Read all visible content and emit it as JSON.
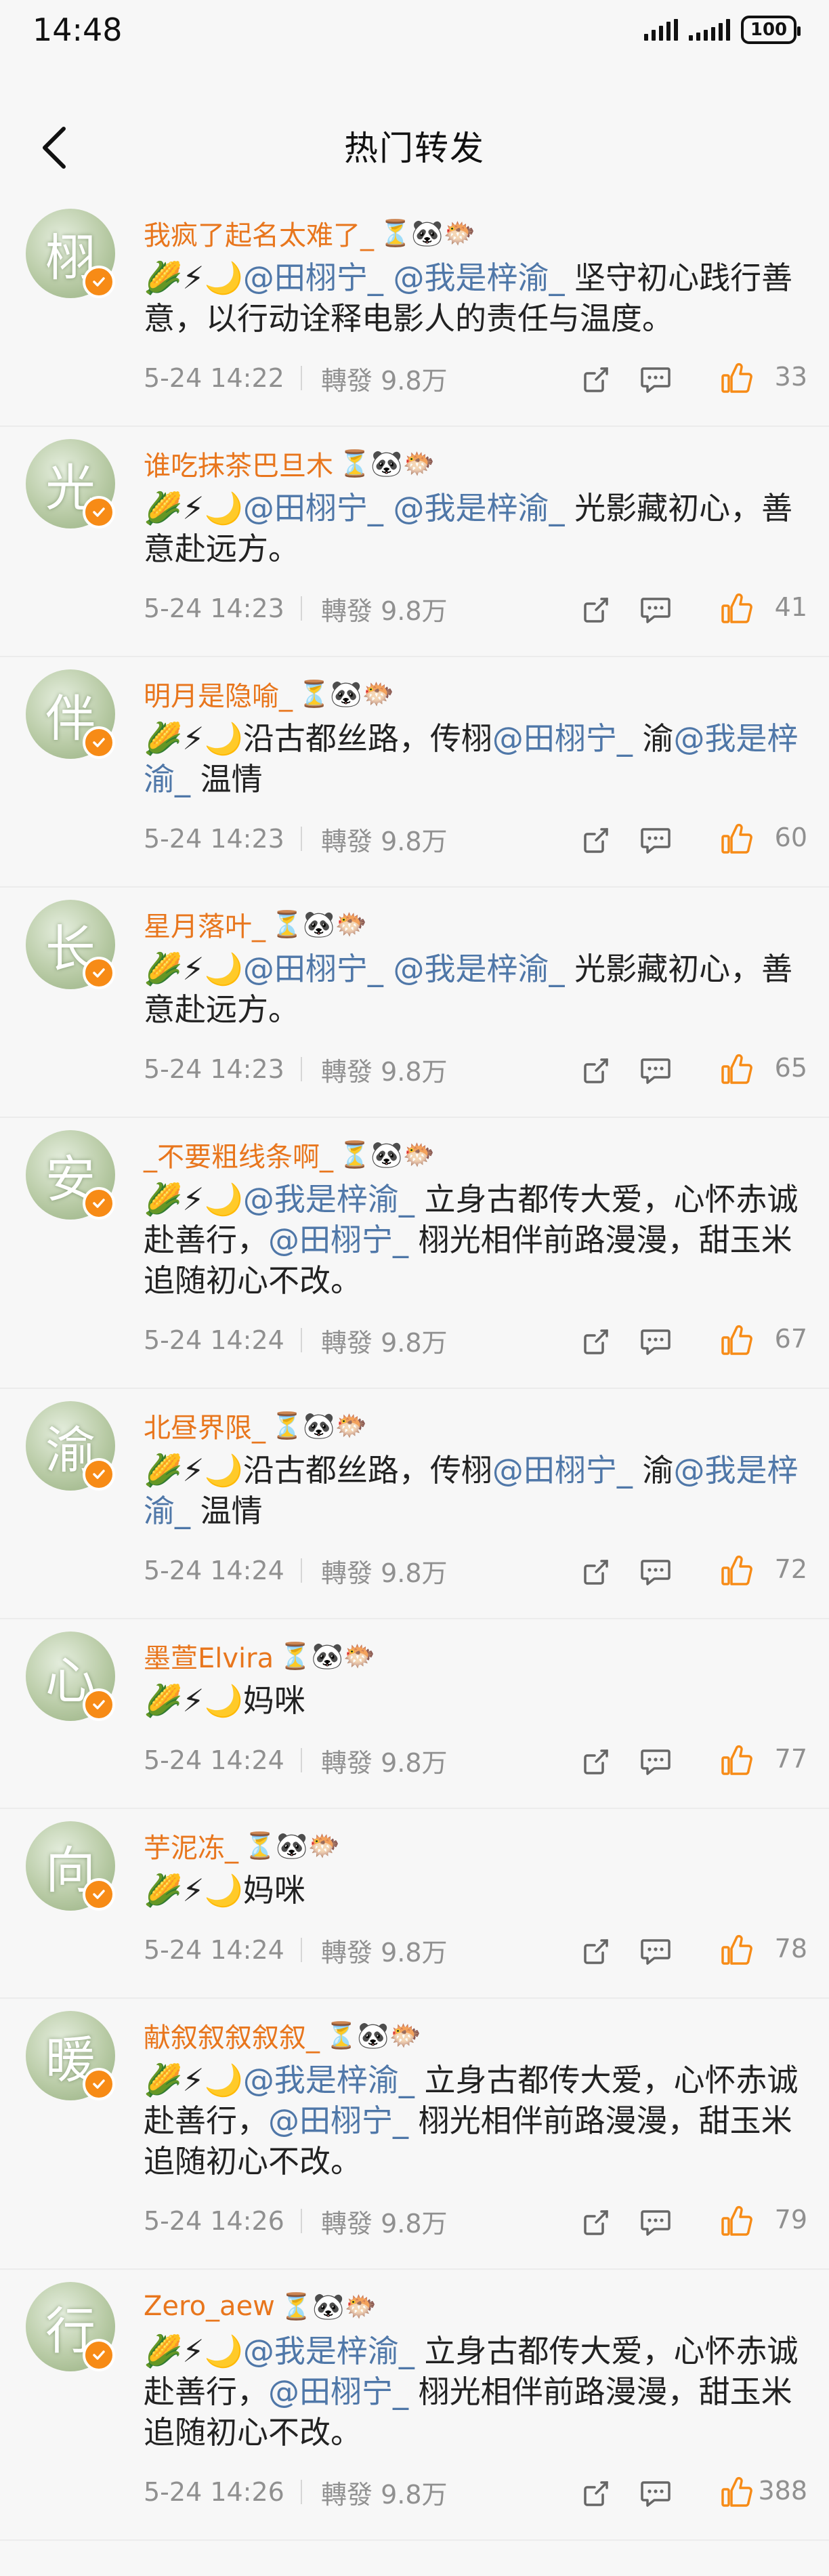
{
  "status": {
    "time": "14:48",
    "battery": "100"
  },
  "header": {
    "title": "热门转发"
  },
  "colors": {
    "username": "#e8761d",
    "mention": "#4f77a8",
    "like": "#f78b16"
  },
  "icons": [
    "back-icon",
    "share-icon",
    "comment-icon",
    "like-icon",
    "verified-badge-icon"
  ],
  "posts": [
    {
      "avatar_char": "栩",
      "username": "我疯了起名太难了_",
      "badges": "⏳🐼🐡",
      "segments": [
        {
          "t": "🌽⚡🌙"
        },
        {
          "t": "@田栩宁_",
          "m": true
        },
        {
          "t": " "
        },
        {
          "t": "@我是梓渝_",
          "m": true
        },
        {
          "t": " 坚守初心践行善意，以行动诠释电影人的责任与温度。"
        }
      ],
      "lines": 2,
      "time": "5-24 14:22",
      "repost": "轉發 9.8万",
      "likes": "33"
    },
    {
      "avatar_char": "光",
      "username": "谁吃抹茶巴旦木",
      "badges": "⏳🐼🐡",
      "segments": [
        {
          "t": "🌽⚡🌙"
        },
        {
          "t": "@田栩宁_",
          "m": true
        },
        {
          "t": " "
        },
        {
          "t": "@我是梓渝_",
          "m": true
        },
        {
          "t": " 光影藏初心，善意赴远方。"
        }
      ],
      "lines": 2,
      "time": "5-24 14:23",
      "repost": "轉發 9.8万",
      "likes": "41"
    },
    {
      "avatar_char": "伴",
      "username": "明月是隐喻_",
      "badges": "⏳🐼🐡",
      "segments": [
        {
          "t": "🌽⚡🌙沿古都丝路，传栩"
        },
        {
          "t": "@田栩宁_",
          "m": true
        },
        {
          "t": " 渝"
        },
        {
          "t": "@我是梓渝_",
          "m": true
        },
        {
          "t": " 温情"
        }
      ],
      "lines": 2,
      "time": "5-24 14:23",
      "repost": "轉發 9.8万",
      "likes": "60"
    },
    {
      "avatar_char": "长",
      "username": "星月落叶_",
      "badges": "⏳🐼🐡",
      "segments": [
        {
          "t": "🌽⚡🌙"
        },
        {
          "t": "@田栩宁_",
          "m": true
        },
        {
          "t": " "
        },
        {
          "t": "@我是梓渝_",
          "m": true
        },
        {
          "t": " 光影藏初心，善意赴远方。"
        }
      ],
      "lines": 2,
      "time": "5-24 14:23",
      "repost": "轉發 9.8万",
      "likes": "65"
    },
    {
      "avatar_char": "安",
      "username": "_不要粗线条啊_",
      "badges": "⏳🐼🐡",
      "segments": [
        {
          "t": "🌽⚡🌙"
        },
        {
          "t": "@我是梓渝_",
          "m": true
        },
        {
          "t": " 立身古都传大爱，心怀赤诚赴善行，"
        },
        {
          "t": "@田栩宁_",
          "m": true
        },
        {
          "t": " 栩光相伴前路漫漫，甜玉米追随初心不改。"
        }
      ],
      "lines": 3,
      "time": "5-24 14:24",
      "repost": "轉發 9.8万",
      "likes": "67"
    },
    {
      "avatar_char": "渝",
      "username": "北昼界限_",
      "badges": "⏳🐼🐡",
      "segments": [
        {
          "t": "🌽⚡🌙沿古都丝路，传栩"
        },
        {
          "t": "@田栩宁_",
          "m": true
        },
        {
          "t": " 渝"
        },
        {
          "t": "@我是梓渝_",
          "m": true
        },
        {
          "t": " 温情"
        }
      ],
      "lines": 2,
      "time": "5-24 14:24",
      "repost": "轉發 9.8万",
      "likes": "72"
    },
    {
      "avatar_char": "心",
      "username": "墨萱Elvira",
      "badges": "⏳🐼🐡",
      "segments": [
        {
          "t": "🌽⚡🌙妈咪"
        }
      ],
      "lines": 1,
      "time": "5-24 14:24",
      "repost": "轉發 9.8万",
      "likes": "77"
    },
    {
      "avatar_char": "向",
      "username": "芋泥冻_",
      "badges": "⏳🐼🐡",
      "segments": [
        {
          "t": "🌽⚡🌙妈咪"
        }
      ],
      "lines": 1,
      "time": "5-24 14:24",
      "repost": "轉發 9.8万",
      "likes": "78"
    },
    {
      "avatar_char": "暖",
      "username": "献叙叙叙叙叙_",
      "badges": "⏳🐼🐡",
      "segments": [
        {
          "t": "🌽⚡🌙"
        },
        {
          "t": "@我是梓渝_",
          "m": true
        },
        {
          "t": " 立身古都传大爱，心怀赤诚赴善行，"
        },
        {
          "t": "@田栩宁_",
          "m": true
        },
        {
          "t": " 栩光相伴前路漫漫，甜玉米追随初心不改。"
        }
      ],
      "lines": 3,
      "time": "5-24 14:26",
      "repost": "轉發 9.8万",
      "likes": "79"
    },
    {
      "avatar_char": "行",
      "username": "Zero_aew",
      "badges": "⏳🐼🐡",
      "segments": [
        {
          "t": "🌽⚡🌙"
        },
        {
          "t": "@我是梓渝_",
          "m": true
        },
        {
          "t": " 立身古都传大爱，心怀赤诚赴善行，"
        },
        {
          "t": "@田栩宁_",
          "m": true
        },
        {
          "t": " 栩光相伴前路漫漫，甜玉米追随初心不改。"
        }
      ],
      "lines": 3,
      "time": "5-24 14:26",
      "repost": "轉發 9.8万",
      "likes": "388"
    }
  ]
}
